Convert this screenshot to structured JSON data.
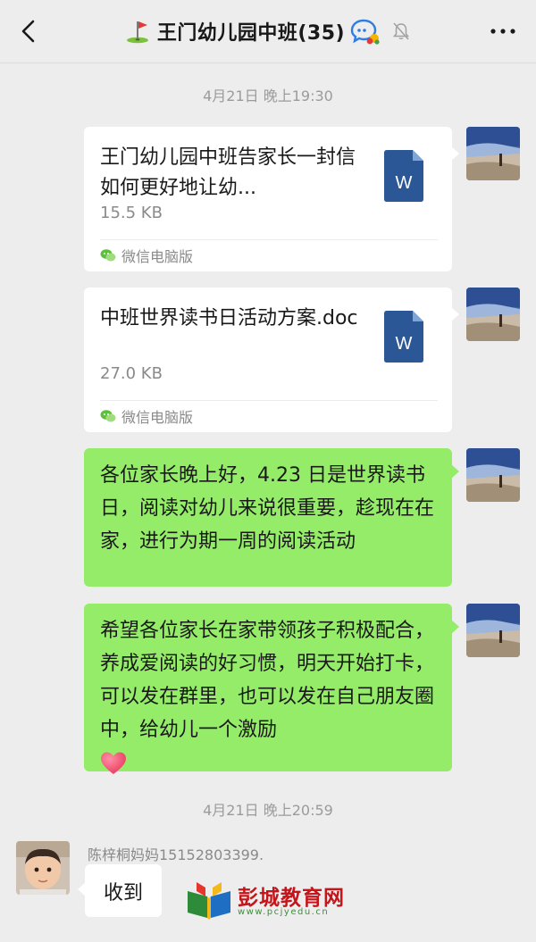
{
  "header": {
    "title": "王门幼儿园中班(35)",
    "icons": [
      "back-icon",
      "golf-flag-icon",
      "chat-badge-icon",
      "mute-bell-icon",
      "more-icon"
    ]
  },
  "timestamps": [
    "4月21日 晚上19:30",
    "4月21日 晚上20:59"
  ],
  "messages": [
    {
      "type": "file",
      "name": "王门幼儿园中班告家长一封信如何更好地让幼...",
      "size": "15.5 KB",
      "source": "微信电脑版"
    },
    {
      "type": "file",
      "name": "中班世界读书日活动方案.doc",
      "size": "27.0 KB",
      "source": "微信电脑版"
    },
    {
      "type": "text",
      "text": "各位家长晚上好，4.23 日是世界读书日，阅读对幼儿来说很重要，趁现在在家，进行为期一周的阅读活动"
    },
    {
      "type": "text",
      "text": "希望各位家长在家带领孩子积极配合，养成爱阅读的好习惯，明天开始打卡，可以发在群里，也可以发在自己朋友圈中，给幼儿一个激励"
    }
  ],
  "incoming": {
    "sender": "陈梓桐妈妈15152803399.",
    "text": "收到"
  },
  "watermark": {
    "name": "彭城教育网",
    "url": "www.pcjyedu.cn"
  },
  "colors": {
    "background": "#ededed",
    "bubble_green": "#95ec69",
    "word_icon": "#2b5797",
    "watermark_red": "#c6151a"
  }
}
